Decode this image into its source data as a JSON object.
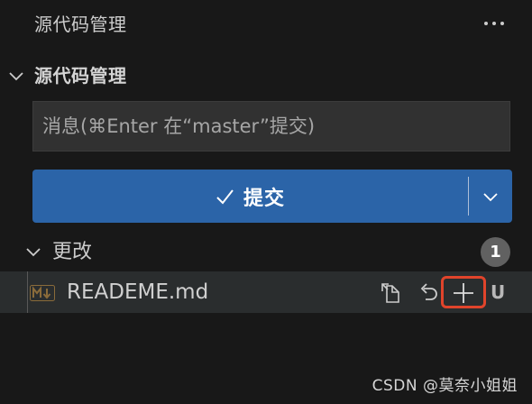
{
  "view": {
    "title": "源代码管理",
    "more_icon": "ellipsis-icon"
  },
  "section": {
    "title": "源代码管理",
    "expanded": true
  },
  "message_input": {
    "placeholder": "消息(⌘Enter 在“master”提交)",
    "value": ""
  },
  "commit_button": {
    "label": "提交",
    "icon": "check-icon",
    "dropdown_icon": "chevron-down-icon",
    "color": "#2b64a8"
  },
  "changes": {
    "title": "更改",
    "count": "1",
    "files": [
      {
        "name": "READEME.md",
        "file_icon": "markdown-icon",
        "actions": [
          "open-file-icon",
          "discard-changes-icon",
          "stage-changes-icon"
        ],
        "status": "U"
      }
    ]
  },
  "highlight_color": "#e0442b",
  "watermark": "CSDN @莫奈小姐姐"
}
